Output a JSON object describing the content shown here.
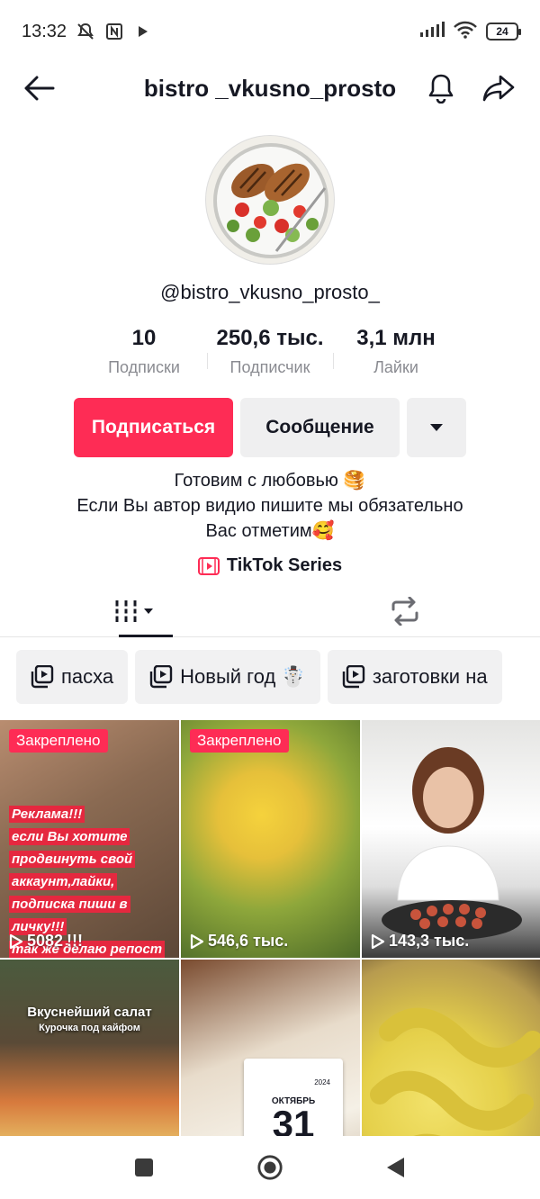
{
  "status_bar": {
    "time": "13:32",
    "battery": "24"
  },
  "header": {
    "title": "bistro _vkusno_prosto"
  },
  "profile": {
    "handle": "@bistro_vkusno_prosto_"
  },
  "stats": [
    {
      "value": "10",
      "label": "Подписки"
    },
    {
      "value": "250,6 тыс.",
      "label": "Подписчик"
    },
    {
      "value": "3,1 млн",
      "label": "Лайки"
    }
  ],
  "actions": {
    "follow": "Подписаться",
    "message": "Сообщение"
  },
  "bio": {
    "line1": "Готовим с любовью 🥞",
    "line2": "Если Вы автор видио пишите мы обязательно",
    "line3": "Вас отметим🥰"
  },
  "series_link": "TikTok Series",
  "playlists": [
    "пасха",
    "Новый год ☃️",
    "заготовки на"
  ],
  "videos": [
    {
      "pinned_label": "Закреплено",
      "views": "5082",
      "overlay": [
        "Реклама!!!",
        "если Вы хотите",
        "продвинуть свой",
        "аккаунт,лайки,",
        "подписка пиши в личку!!!",
        "так же делаю репост в",
        "!!!"
      ]
    },
    {
      "pinned_label": "Закреплено",
      "views": "546,6 тыс."
    },
    {
      "views": "143,3 тыс."
    },
    {
      "title": "Вкуснейший салат",
      "subtitle": "Курочка под кайфом"
    },
    {
      "calendar_month": "ОКТЯБРЬ",
      "calendar_day": "31",
      "calendar_year": "2024"
    },
    {}
  ],
  "colors": {
    "accent": "#fe2c55",
    "text": "#161823",
    "muted": "#8a8b91"
  }
}
